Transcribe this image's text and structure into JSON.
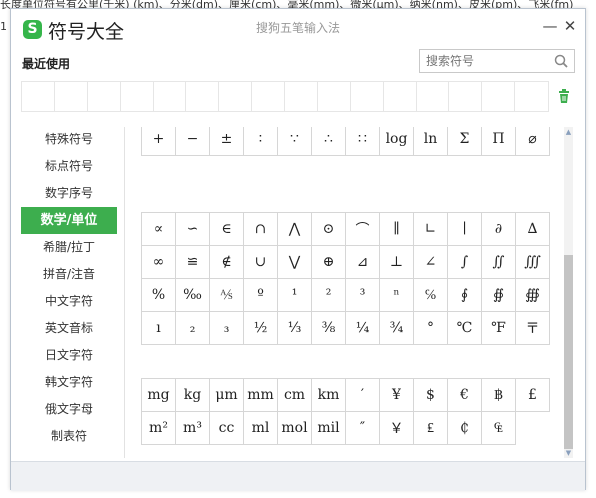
{
  "background": {
    "top_text": "长度单位符号有公里(千米) (km)、分米(dm)、厘米(cm)、毫米(mm)、微米(μm)、纳米(nm)、皮米(pm)、飞米(fm)",
    "left_number": "1"
  },
  "window": {
    "logo_letter": "S",
    "title": "符号大全",
    "subtitle": "搜狗五笔输入法",
    "minimize_label": "—",
    "close_label": "✕",
    "accent_color": "#3dae4e"
  },
  "recent": {
    "label": "最近使用"
  },
  "search": {
    "placeholder": "搜索符号"
  },
  "sidebar": {
    "items": [
      {
        "label": "特殊符号"
      },
      {
        "label": "标点符号"
      },
      {
        "label": "数字序号"
      },
      {
        "label": "数学/单位",
        "active": true
      },
      {
        "label": "希腊/拉丁"
      },
      {
        "label": "拼音/注音"
      },
      {
        "label": "中文字符"
      },
      {
        "label": "英文音标"
      },
      {
        "label": "日文字符"
      },
      {
        "label": "韩文字符"
      },
      {
        "label": "俄文字母"
      },
      {
        "label": "制表符"
      }
    ]
  },
  "symbols": {
    "group1": [
      "+",
      "−",
      "±",
      "∶",
      "∵",
      "∴",
      "∷",
      "log",
      "ln",
      "Σ",
      "Π",
      "⌀"
    ],
    "group2": [
      "∝",
      "∽",
      "∈",
      "∩",
      "⋀",
      "⊙",
      "⌒",
      "∥",
      "∟",
      "∣",
      "∂",
      "∆",
      "∞",
      "≌",
      "∉",
      "∪",
      "⋁",
      "⊕",
      "⊿",
      "⊥",
      "∠",
      "∫",
      "∬",
      "∭",
      "%",
      "‰",
      "⅍",
      "º",
      "¹",
      "²",
      "³",
      "ⁿ",
      "℅",
      "∮",
      "∯",
      "∰",
      "ı",
      "₂",
      "₃",
      "½",
      "⅓",
      "⅜",
      "¼",
      "¾",
      "°",
      "℃",
      "℉",
      "〒"
    ],
    "group3": [
      "mg",
      "kg",
      "μm",
      "mm",
      "cm",
      "km",
      "′",
      "¥",
      "$",
      "€",
      "฿",
      "£",
      "m²",
      "m³",
      "cc",
      "ml",
      "mol",
      "mil",
      "″",
      "￥",
      "₤",
      "₵",
      "₠"
    ]
  }
}
